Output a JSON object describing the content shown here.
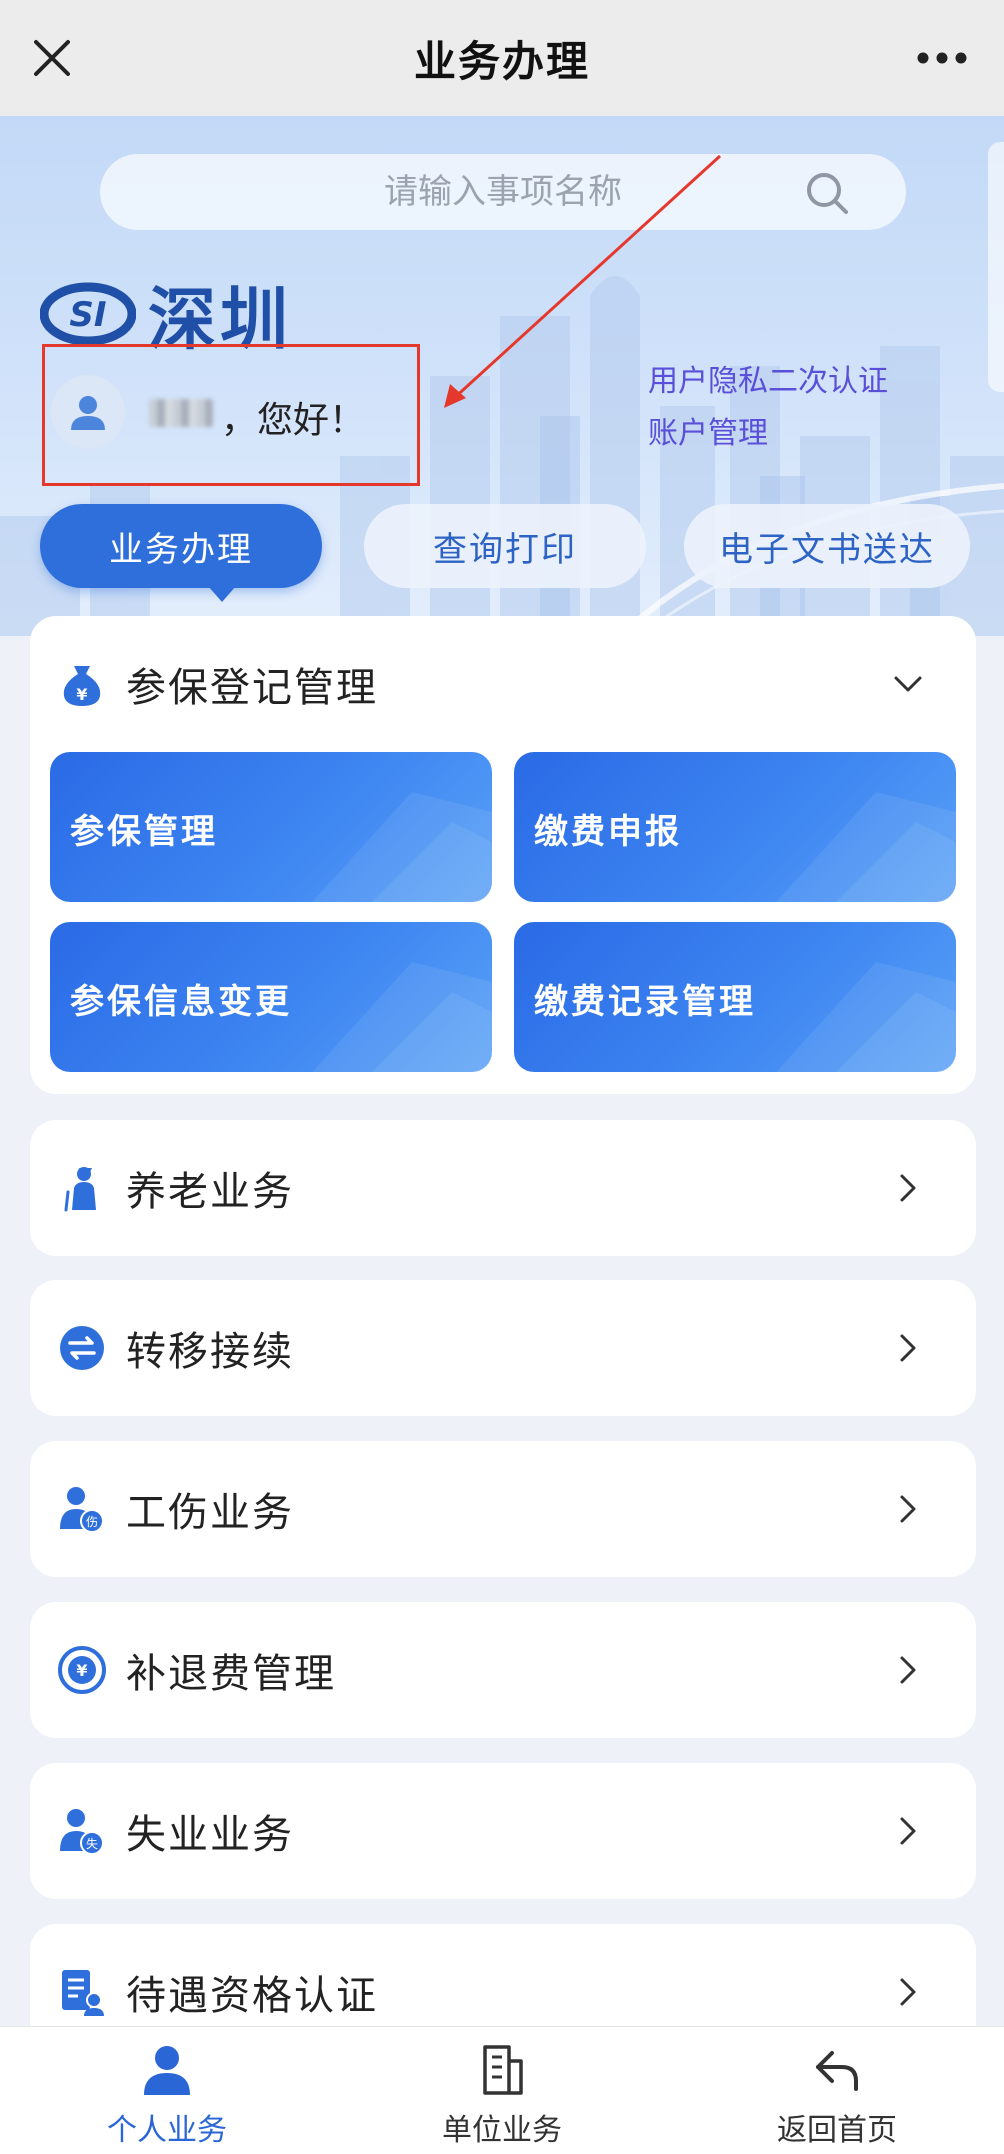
{
  "window": {
    "title": "业务办理"
  },
  "search": {
    "placeholder": "请输入事项名称"
  },
  "brand": {
    "logo_text": "深圳"
  },
  "user": {
    "greeting": "，您好！"
  },
  "header_links": {
    "privacy_auth": "用户隐私二次认证",
    "account_manage": "账户管理"
  },
  "tabs": [
    {
      "label": "业务办理",
      "active": true
    },
    {
      "label": "查询打印",
      "active": false
    },
    {
      "label": "电子文书送达",
      "active": false
    }
  ],
  "sections": {
    "registration": {
      "title": "参保登记管理",
      "expanded": true,
      "tiles": [
        {
          "label": "参保管理"
        },
        {
          "label": "缴费申报"
        },
        {
          "label": "参保信息变更"
        },
        {
          "label": "缴费记录管理"
        }
      ]
    },
    "list": [
      {
        "title": "养老业务",
        "icon": "elderly-icon"
      },
      {
        "title": "转移接续",
        "icon": "transfer-icon"
      },
      {
        "title": "工伤业务",
        "icon": "work-injury-icon"
      },
      {
        "title": "补退费管理",
        "icon": "refund-icon"
      },
      {
        "title": "失业业务",
        "icon": "unemployment-icon"
      },
      {
        "title": "待遇资格认证",
        "icon": "qualification-icon"
      }
    ]
  },
  "bottom_nav": [
    {
      "label": "个人业务",
      "active": true
    },
    {
      "label": "单位业务",
      "active": false
    },
    {
      "label": "返回首页",
      "active": false
    }
  ],
  "colors": {
    "accent": "#2f6fdb",
    "link": "#5a4fd8",
    "annotation_red": "#e5382d",
    "nav_active": "#2a66d6"
  }
}
